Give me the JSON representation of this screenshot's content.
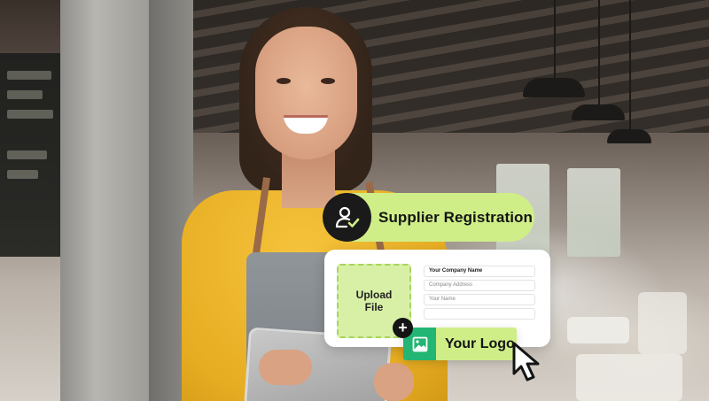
{
  "registration_pill": {
    "label": "Supplier Registration",
    "icon": "user-check-icon",
    "background": "#cfee88",
    "icon_background": "#1a1a1a"
  },
  "form_card": {
    "upload": {
      "label_line1": "Upload",
      "label_line2": "File"
    },
    "fields": [
      {
        "text": "Your Company Name"
      },
      {
        "text": "Company Address"
      },
      {
        "text": "Your Name"
      },
      {
        "text": ""
      }
    ]
  },
  "logo_chip": {
    "label": "Your Logo",
    "icon": "image-icon",
    "icon_background": "#22b573"
  },
  "add_button": {
    "icon": "plus-icon",
    "glyph": "+"
  },
  "cursor": {
    "icon": "mouse-pointer-icon"
  },
  "colors": {
    "accent_green": "#cfee88",
    "logo_green": "#22b573",
    "shirt_yellow": "#f5c33c"
  }
}
